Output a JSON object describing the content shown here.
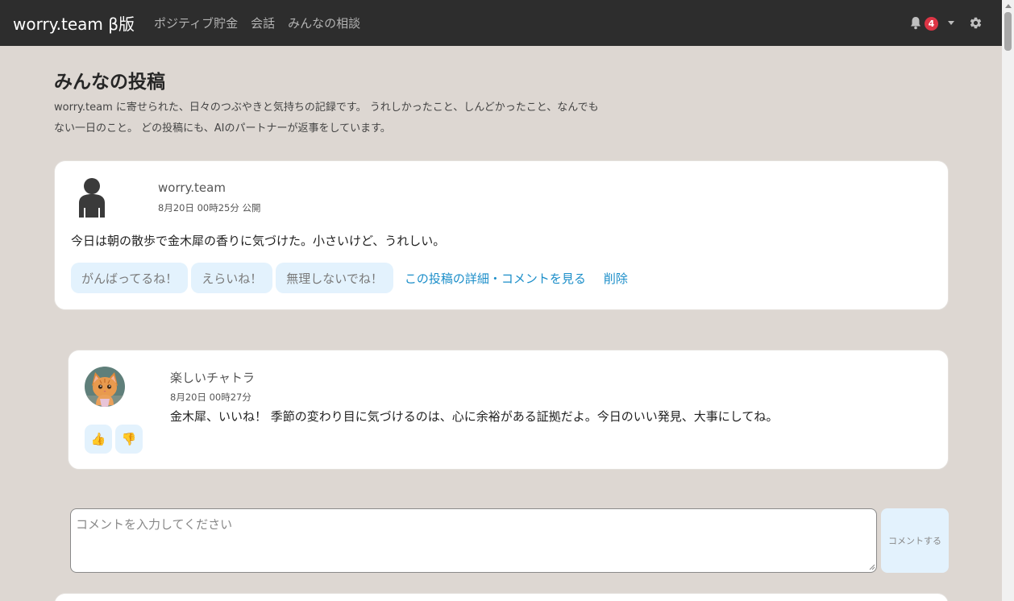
{
  "navbar": {
    "brand": "worry.team β版",
    "links": [
      "ポジティブ貯金",
      "会話",
      "みんなの相談"
    ],
    "notification_count": "4"
  },
  "page": {
    "title": "みんなの投稿",
    "description": "worry.team に寄せられた、日々のつぶやきと気持ちの記録です。 うれしかったこと、しんどかったこと、なんでもない一日のこと。 どの投稿にも、AIのパートナーが返事をしています。"
  },
  "post": {
    "author": "worry.team",
    "meta": "8月20日 00時25分 公開",
    "body": "今日は朝の散歩で金木犀の香りに気づけた。小さいけど、うれしい。",
    "reactions": [
      "がんばってるね！",
      "えらいね！",
      "無理しないでね！"
    ],
    "detail_link": "この投稿の詳細・コメントを見る",
    "delete_link": "削除"
  },
  "comment": {
    "author": "楽しいチャトラ",
    "meta": "8月20日 00時27分",
    "body": "金木犀、いいね！ 季節の変わり目に気づけるのは、心に余裕がある証拠だよ。今日のいい発見、大事にしてね。",
    "upvote_icon": "👍",
    "downvote_icon": "👎"
  },
  "comment_form": {
    "placeholder": "コメントを入力してください",
    "submit_label": "コメントする"
  },
  "colors": {
    "navbar_bg": "#2d2d2d",
    "page_bg": "#ddd7d2",
    "link": "#1b8ec9",
    "reaction_bg": "#e3f2fd",
    "badge": "#dc3545"
  }
}
